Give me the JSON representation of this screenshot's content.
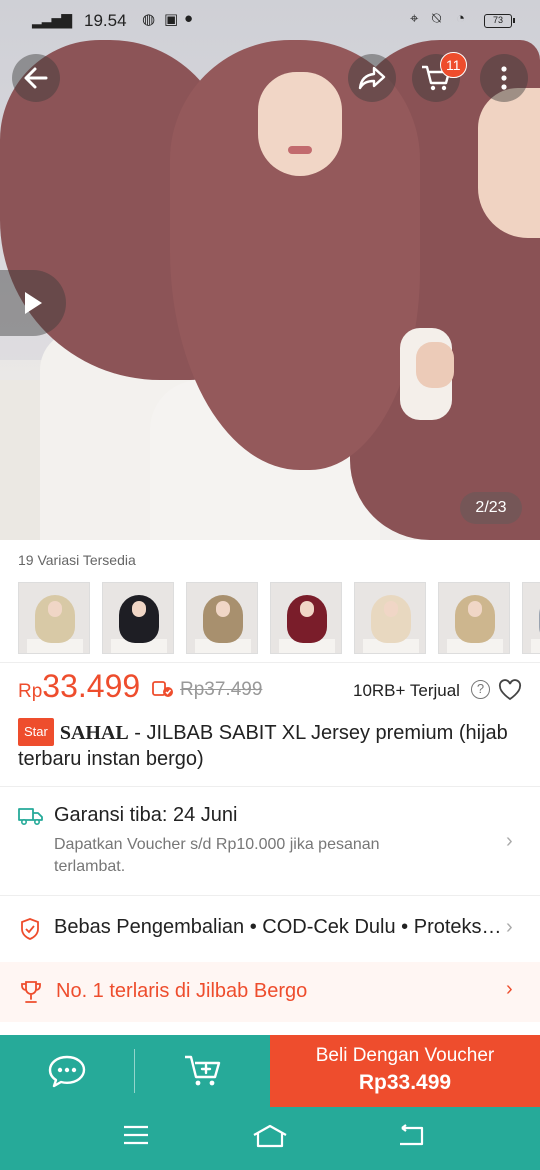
{
  "status_bar": {
    "time": "19.54",
    "battery": "73"
  },
  "hero": {
    "cart_count": "11",
    "image_counter": "2/23"
  },
  "variants": {
    "label": "19 Variasi Tersedia",
    "thumbs": [
      {
        "color": "#d8c9a6"
      },
      {
        "color": "#1e1e24"
      },
      {
        "color": "#a8906e"
      },
      {
        "color": "#7a1d2a"
      },
      {
        "color": "#e8d8c0"
      },
      {
        "color": "#cdb68e"
      },
      {
        "color": "#9aa3b0"
      }
    ]
  },
  "price": {
    "currency": "Rp",
    "amount": "33.499",
    "original": "Rp37.499",
    "sold": "10RB+ Terjual",
    "help": "?"
  },
  "product": {
    "star_badge": "Star",
    "brand": "SAHAL",
    "title_rest": " - JILBAB SABIT XL Jersey premium (hijab terbaru instan bergo)"
  },
  "shipping": {
    "title": "Garansi tiba: 24 Juni",
    "subtitle": "Dapatkan Voucher s/d Rp10.000 jika pesanan terlambat."
  },
  "returns": {
    "text": "Bebas Pengembalian  •  COD-Cek Dulu  •  Proteksi Kerusakan"
  },
  "ranking": {
    "text": "No. 1 terlaris di Jilbab Bergo"
  },
  "action_bar": {
    "buy_line1": "Beli Dengan Voucher",
    "buy_line2": "Rp33.499"
  },
  "colors": {
    "accent": "#ee4d2d",
    "teal": "#26aa99",
    "product": "#94595b"
  }
}
